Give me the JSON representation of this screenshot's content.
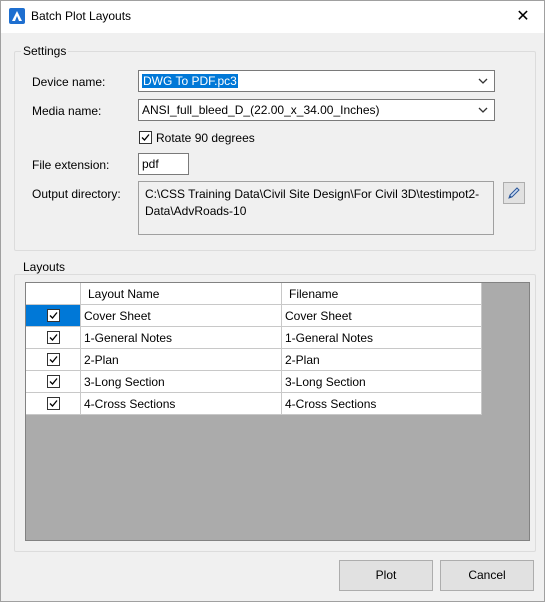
{
  "window": {
    "title": "Batch Plot Layouts",
    "close_glyph": "✕"
  },
  "settings": {
    "group_label": "Settings",
    "device_label": "Device name:",
    "device_value": "DWG To PDF.pc3",
    "media_label": "Media name:",
    "media_value": "ANSI_full_bleed_D_(22.00_x_34.00_Inches)",
    "rotate_label": "Rotate 90 degrees",
    "rotate_checked": true,
    "ext_label": "File extension:",
    "ext_value": "pdf",
    "outdir_label": "Output directory:",
    "outdir_value": "C:\\CSS Training Data\\Civil Site Design\\For Civil 3D\\testimpot2-Data\\AdvRoads-10"
  },
  "layouts": {
    "group_label": "Layouts",
    "columns": [
      "",
      "Layout Name",
      "Filename"
    ],
    "rows": [
      {
        "checked": true,
        "name": "Cover Sheet",
        "filename": "Cover Sheet"
      },
      {
        "checked": true,
        "name": "1-General Notes",
        "filename": "1-General Notes"
      },
      {
        "checked": true,
        "name": "2-Plan",
        "filename": "2-Plan"
      },
      {
        "checked": true,
        "name": "3-Long Section",
        "filename": "3-Long Section"
      },
      {
        "checked": true,
        "name": "4-Cross Sections",
        "filename": "4-Cross Sections"
      }
    ]
  },
  "buttons": {
    "plot": "Plot",
    "cancel": "Cancel"
  },
  "icons": {
    "app": "app-logo-icon",
    "close": "close-icon",
    "dropdown": "chevron-down-icon",
    "browse": "pencil-icon",
    "check": "checkmark-icon"
  },
  "colors": {
    "selection": "#0078d7",
    "grid_background": "#ababab"
  }
}
